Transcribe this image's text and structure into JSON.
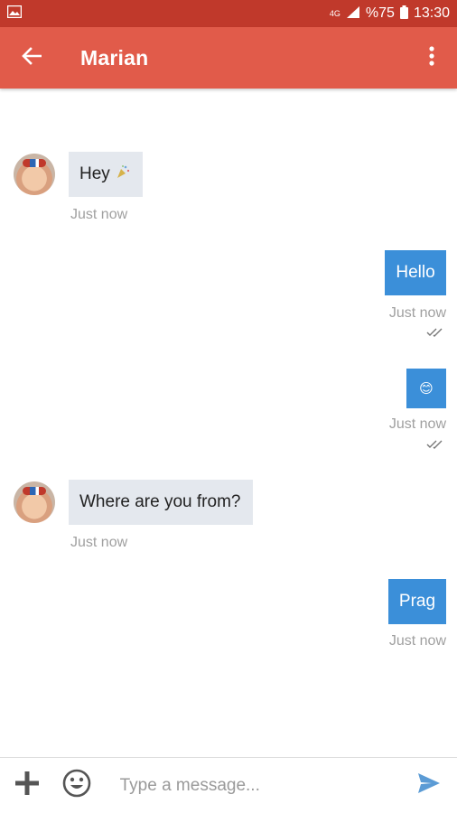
{
  "status_bar": {
    "network": "4G",
    "battery": "%75",
    "time": "13:30",
    "icons": [
      "image-icon",
      "signal-icon",
      "battery-icon"
    ]
  },
  "header": {
    "title": "Marian",
    "back_icon": "arrow-left-icon",
    "menu_icon": "more-vertical-icon",
    "bg_color": "#e15b4a"
  },
  "messages": [
    {
      "direction": "in",
      "text": "Hey",
      "emoji_icon": "party-popper-icon",
      "time": "Just now"
    },
    {
      "direction": "out",
      "text": "Hello",
      "time": "Just now",
      "read": true
    },
    {
      "direction": "out",
      "text": "😊",
      "time": "Just now",
      "read": true
    },
    {
      "direction": "in",
      "text": "Where are you from?",
      "time": "Just now"
    },
    {
      "direction": "out",
      "text": "Prag",
      "time": "Just now",
      "read": false
    }
  ],
  "composer": {
    "placeholder": "Type a message...",
    "add_icon": "plus-icon",
    "emoji_icon": "smiley-icon",
    "send_icon": "send-icon",
    "send_color": "#5b9bd5"
  }
}
